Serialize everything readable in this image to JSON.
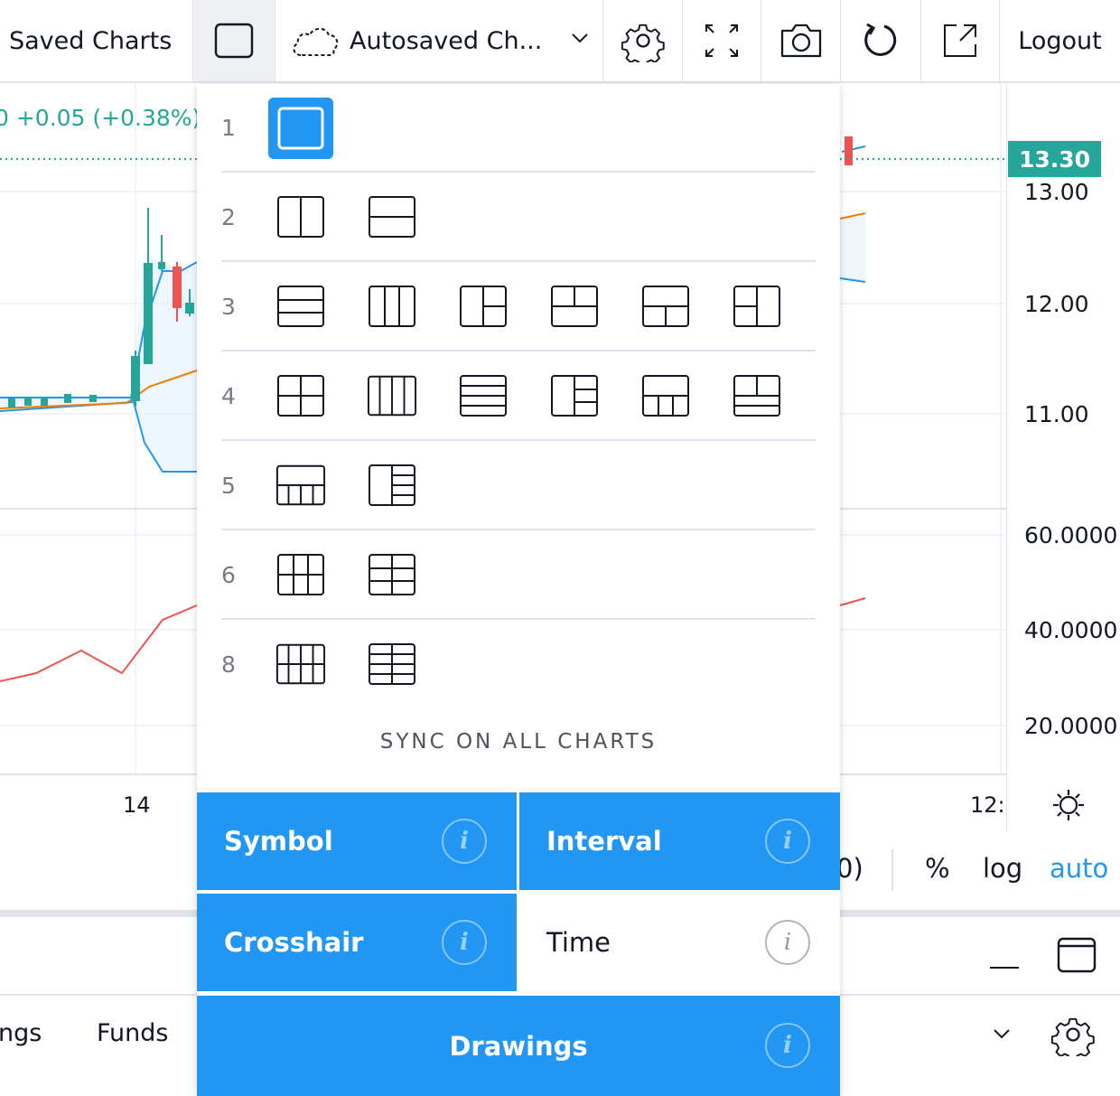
{
  "toolbar": {
    "saved_charts": "Saved Charts",
    "autosave_label": "Autosaved Ch...",
    "logout": "Logout",
    "icons": [
      "layout-icon",
      "cloud-icon",
      "chevron-down-icon",
      "gear-icon",
      "fullscreen-icon",
      "camera-icon",
      "refresh-icon",
      "popout-icon"
    ]
  },
  "chart": {
    "change": "0  +0.05 (+0.38%)",
    "last_price": "13.30",
    "price_scale": [
      "13.00",
      "12.00",
      "11.00"
    ],
    "indicator_scale": [
      "60.0000",
      "40.0000",
      "20.0000"
    ],
    "time_labels": [
      "14",
      "12:"
    ],
    "scale_buttons": {
      "paren": "0)",
      "percent": "%",
      "log": "log",
      "auto": "auto"
    },
    "colors": {
      "up": "#26a69a",
      "down": "#ef5350",
      "band": "#2196f3",
      "ma": "#f57c00",
      "accent": "#2196f3"
    }
  },
  "layout_menu": {
    "rows": [
      {
        "label": "1",
        "options": [
          "single"
        ]
      },
      {
        "label": "2",
        "options": [
          "2-vertical",
          "2-horizontal"
        ]
      },
      {
        "label": "3",
        "options": [
          "3-horizontal",
          "3-vertical",
          "1-left-2-right",
          "2-top-1-bottom",
          "1-top-2-bottom",
          "2-left-1-right"
        ]
      },
      {
        "label": "4",
        "options": [
          "grid-2x2",
          "4-vertical",
          "4-horizontal",
          "1-left-3-right",
          "1-top-3-bottom",
          "3-top-1-bottom"
        ]
      },
      {
        "label": "5",
        "options": [
          "1-top-4-bottom",
          "1-left-4-right"
        ]
      },
      {
        "label": "6",
        "options": [
          "grid-3x2",
          "grid-2x3"
        ]
      },
      {
        "label": "8",
        "options": [
          "grid-4x2",
          "grid-2x4"
        ]
      }
    ],
    "sync_title": "SYNC ON ALL CHARTS",
    "sync": {
      "symbol": "Symbol",
      "interval": "Interval",
      "crosshair": "Crosshair",
      "time": "Time",
      "drawings": "Drawings",
      "info_glyph": "i"
    }
  },
  "bottom_panel": {
    "tabs": [
      "ngs",
      "Funds"
    ]
  }
}
